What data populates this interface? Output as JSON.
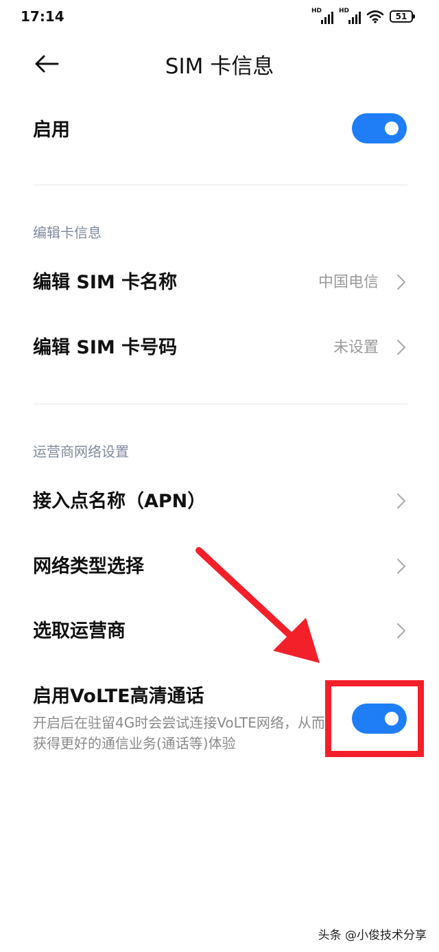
{
  "status_bar": {
    "time": "17:14",
    "sim1_badge": "HD",
    "sim2_badge": "HD",
    "battery": "51"
  },
  "header": {
    "title": "SIM 卡信息"
  },
  "enable_row": {
    "label": "启用",
    "toggle_on": true
  },
  "sections": {
    "card_info": {
      "title": "编辑卡信息",
      "items": [
        {
          "label": "编辑 SIM 卡名称",
          "value": "中国电信"
        },
        {
          "label": "编辑 SIM 卡号码",
          "value": "未设置"
        }
      ]
    },
    "carrier": {
      "title": "运营商网络设置",
      "items": [
        {
          "label": "接入点名称（APN）"
        },
        {
          "label": "网络类型选择"
        },
        {
          "label": "选取运营商"
        }
      ]
    }
  },
  "volte": {
    "label": "启用VoLTE高清通话",
    "description": "开启后在驻留4G时会尝试连接VoLTE网络，从而获得更好的通信业务(通话等)体验",
    "toggle_on": true
  },
  "colors": {
    "accent": "#1f7ef5",
    "annotation": "#f3202a"
  },
  "watermark": "头条 @小俊技术分享"
}
